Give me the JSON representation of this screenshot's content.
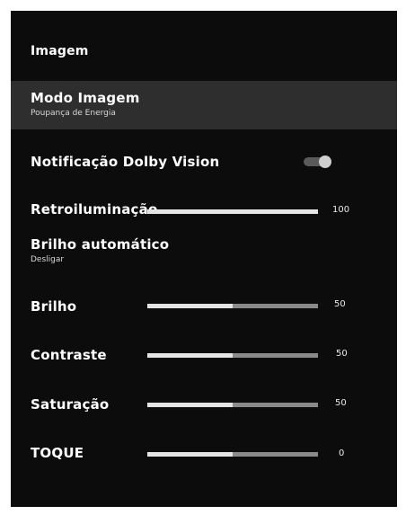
{
  "menu": {
    "title": "Imagem",
    "picture_mode": {
      "label": "Modo Imagem",
      "value": "Poupança de Energia"
    },
    "dolby_notification": {
      "label": "Notificação Dolby Vision",
      "enabled": true
    },
    "backlight": {
      "label": "Retroiluminação",
      "value": "100",
      "level": 1.0
    },
    "auto_brightness": {
      "label": "Brilho automático",
      "value": "Desligar"
    },
    "brightness": {
      "label": "Brilho",
      "value": "50",
      "level": 0.5
    },
    "contrast": {
      "label": "Contraste",
      "value": "50",
      "level": 0.5
    },
    "saturation": {
      "label": "Saturação",
      "value": "50",
      "level": 0.5
    },
    "sharpness": {
      "label": "TOQUE",
      "value": "0",
      "level": 0.5
    }
  },
  "colors": {
    "background": "#0c0c0c",
    "selected_row": "#2e2e2e",
    "slider_fill": "#e4e4e4",
    "slider_track": "#8a8a8a"
  }
}
